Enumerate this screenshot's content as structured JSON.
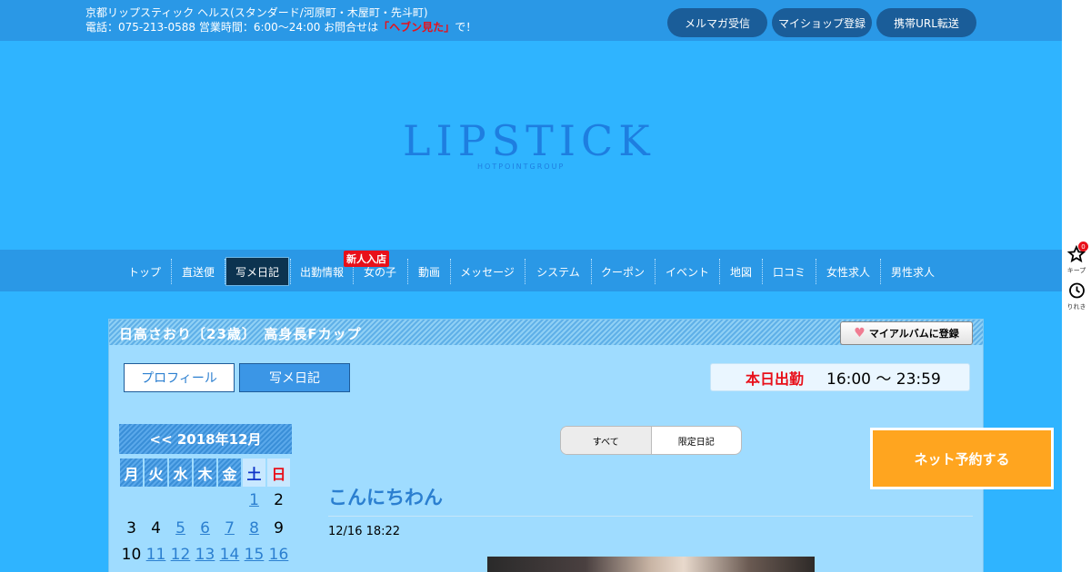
{
  "header": {
    "line1": "京都リップスティック ヘルス(スタンダード/河原町・木屋町・先斗町)",
    "line2_prefix": "電話：075-213-0588 営業時間：6:00～24:00 お問合せは",
    "line2_highlight": "「ヘブン見た」",
    "line2_suffix": "で！",
    "buttons": [
      "メルマガ受信",
      "マイショップ登録",
      "携帯URL転送"
    ]
  },
  "logo": {
    "main": "LIPSTICK",
    "sub": "HOTPOINTGROUP"
  },
  "nav": {
    "items": [
      "トップ",
      "直送便",
      "写メ日記",
      "出勤情報",
      "女の子",
      "動画",
      "メッセージ",
      "システム",
      "クーポン",
      "イベント",
      "地図",
      "口コミ",
      "女性求人",
      "男性求人"
    ],
    "badge": "新人入店"
  },
  "profile": {
    "title": "日高さおり〔23歳〕　高身長Fカップ",
    "album_button": "マイアルバムに登録",
    "tab_profile": "プロフィール",
    "tab_diary": "写メ日記",
    "today_label": "本日出勤",
    "today_time": "16:00 ～ 23:59"
  },
  "calendar": {
    "header": "<< 2018年12月",
    "weekdays": [
      "月",
      "火",
      "水",
      "木",
      "金",
      "土",
      "日"
    ],
    "row1": [
      "",
      "",
      "",
      "",
      "",
      "1",
      "2"
    ],
    "row2": [
      "3",
      "4",
      "5",
      "6",
      "7",
      "8",
      "9"
    ],
    "row3": [
      "10",
      "11",
      "12",
      "13",
      "14",
      "15",
      "16"
    ]
  },
  "filter": {
    "all": "すべて",
    "limited": "限定日記"
  },
  "post": {
    "title": "こんにちわん",
    "date": "12/16 18:22"
  },
  "reserve_button": "ネット予約する",
  "rail": {
    "keep_label": "キープ",
    "keep_count": "0",
    "history_label": "りれき"
  },
  "colors": {
    "accent": "#2a98e6",
    "highlight": "#e8101a",
    "reserve": "#ffa51f"
  }
}
